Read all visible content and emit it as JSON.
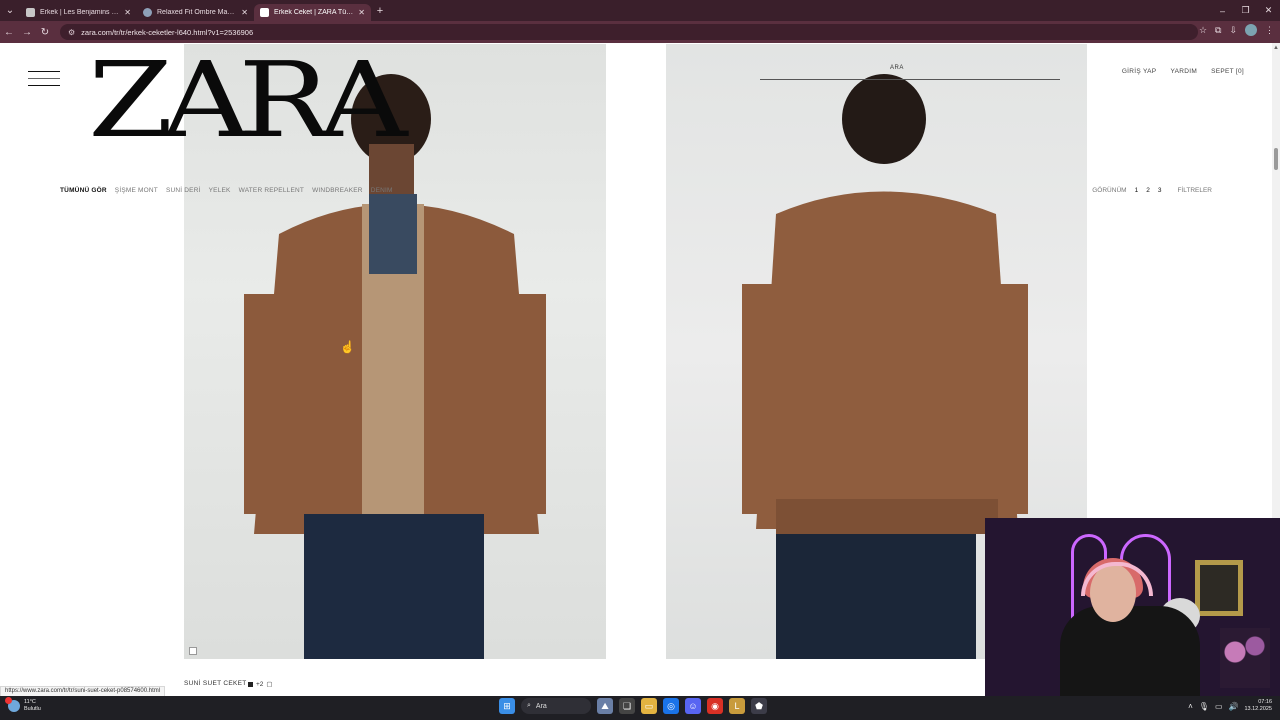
{
  "browser": {
    "tabs": [
      {
        "title": "Erkek | Les Benjamins – LES BEN",
        "active": false
      },
      {
        "title": "Relaxed Fit Ombre Mavi Renkli",
        "active": false
      },
      {
        "title": "Erkek Ceket | ZARA Türkiye",
        "active": true
      }
    ],
    "new_tab": "+",
    "url": "zara.com/tr/tr/erkek-ceketler-l640.html?v1=2536906"
  },
  "site": {
    "logo": "ZARA",
    "search_label": "ARA",
    "top_links": [
      "GİRİŞ YAP",
      "YARDIM",
      "SEPET [0]"
    ],
    "categories": [
      "TÜMÜNÜ GÖR",
      "ŞİŞME MONT",
      "SUNİ DERİ",
      "YELEK",
      "WATER REPELLENT",
      "WINDBREAKER",
      "DENIM"
    ],
    "active_category": "TÜMÜNÜ GÖR",
    "view_label": "GÖRÜNÜM",
    "view_options": [
      "1",
      "2",
      "3"
    ],
    "filters_label": "FİLTRELER",
    "product": {
      "name": "SUNİ SUET CEKET",
      "color_count": "+2"
    },
    "status_url": "https://www.zara.com/tr/tr/suni-suet-ceket-p08574600.html"
  },
  "taskbar": {
    "weather_temp": "11°C",
    "weather_desc": "Bulutlu",
    "search_label": "Ara",
    "time": "07:16",
    "date": "13.12.2025"
  },
  "colors": {
    "tabbar_bg": "#3a1f2b",
    "addrbar_bg": "#5a2f3f",
    "webcam_glow": "#cc67ff"
  }
}
